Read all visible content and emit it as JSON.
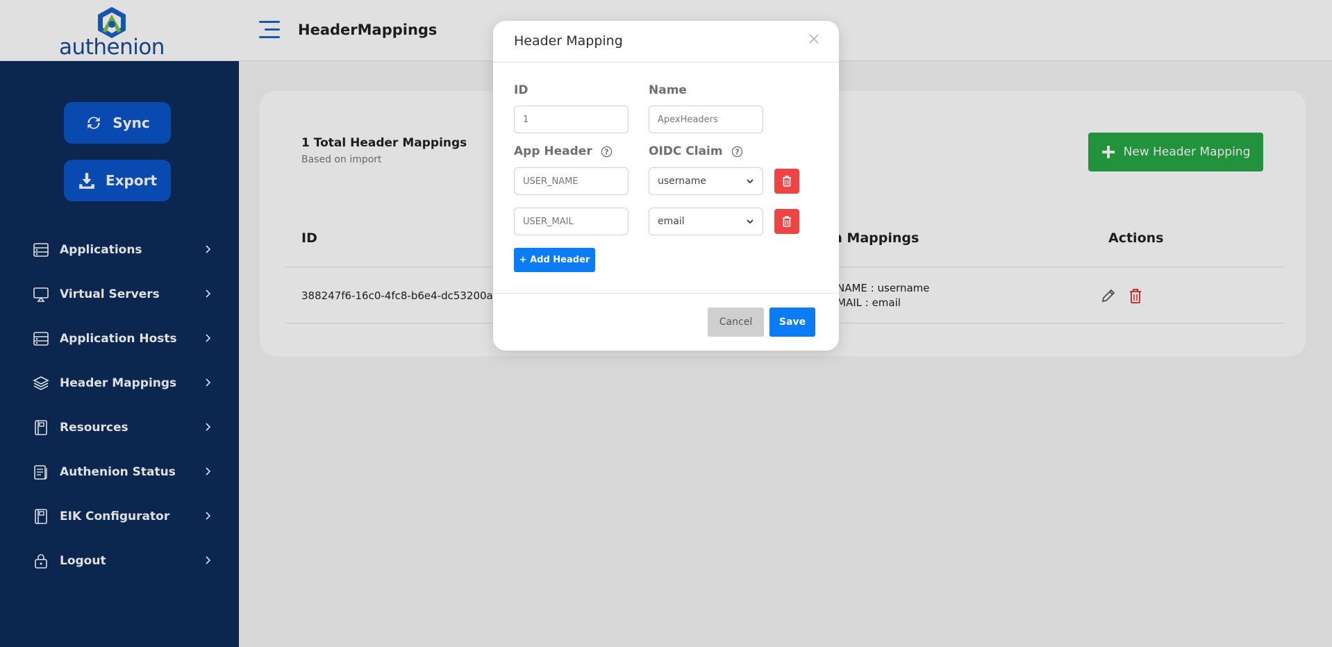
{
  "app": {
    "logo_text": "authenion",
    "page_title": "HeaderMappings"
  },
  "sidebar": {
    "sync_label": "Sync",
    "export_label": "Export",
    "items": [
      {
        "label": "Applications",
        "icon": "applications-icon"
      },
      {
        "label": "Virtual Servers",
        "icon": "monitor-icon"
      },
      {
        "label": "Application Hosts",
        "icon": "server-icon"
      },
      {
        "label": "Header Mappings",
        "icon": "layers-icon"
      },
      {
        "label": "Resources",
        "icon": "book-icon"
      },
      {
        "label": "Authenion Status",
        "icon": "clipboard-icon"
      },
      {
        "label": "EIK Configurator",
        "icon": "book-icon"
      },
      {
        "label": "Logout",
        "icon": "lock-icon"
      }
    ]
  },
  "main": {
    "total_title": "1 Total Header Mappings",
    "total_sub": "Based on import",
    "new_button": "New Header Mapping",
    "columns": [
      "ID",
      "m Mappings",
      "Actions"
    ],
    "rows": [
      {
        "id": "388247f6-16c0-4fc8-b6e4-dc53200afa",
        "mapping_1": "NAME : username",
        "mapping_2": "MAIL : email"
      }
    ]
  },
  "modal": {
    "title": "Header Mapping",
    "id_label": "ID",
    "id_value": "1",
    "name_label": "Name",
    "name_value": "ApexHeaders",
    "app_header_label": "App Header",
    "oidc_claim_label": "OIDC Claim",
    "mappings": [
      {
        "header": "USER_NAME",
        "claim": "username"
      },
      {
        "header": "USER_MAIL",
        "claim": "email"
      }
    ],
    "add_header_label": "+ Add Header",
    "cancel_label": "Cancel",
    "save_label": "Save"
  },
  "colors": {
    "sidebar_bg": "#0d2d5c",
    "primary": "#0b7cf5",
    "success": "#28a745",
    "danger": "#ef4444"
  }
}
